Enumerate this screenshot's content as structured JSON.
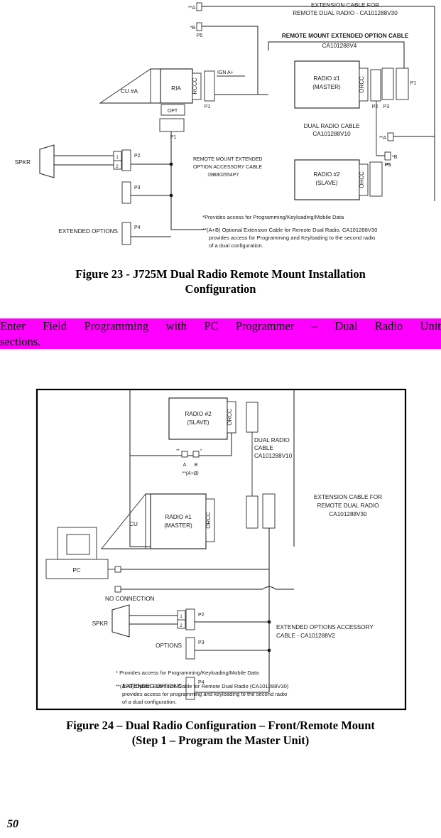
{
  "page": {
    "number": "50"
  },
  "figure23": {
    "caption_line1": "Figure 23 - J725M Dual Radio Remote Mount Installation",
    "caption_line2": "Configuration",
    "labels": {
      "ext_cable_for": "EXTENSION CABLE FOR",
      "remote_dual_radio": "REMOTE DUAL RADIO - CA101288V30",
      "conn_a_top": "**A",
      "conn_b": "*B",
      "p5_top": "P5",
      "remote_mount_ext_option_cable": "REMOTE MOUNT EXTENDED OPTION CABLE",
      "cable_pn_v4": "CA101288V4",
      "cu_a": "CU #A",
      "ria": "RIA",
      "rccc": "RCCC",
      "opt": "OPT",
      "p1_left": "P1",
      "p1_opt": "P1",
      "ign_a_plus": "IGN A+",
      "radio1_line1": "RADIO #1",
      "radio1_line2": "(MASTER)",
      "orcc1": "ORCC",
      "p2": "P2",
      "p3": "P3",
      "p1_right": "P1",
      "dual_radio_cable": "DUAL RADIO  CABLE",
      "dual_radio_cable_pn": "CA101288V10",
      "conn_a_bottom": "**A",
      "conn_b_bottom": "*B",
      "p5_bottom": "P5",
      "radio2_line1": "RADIO #2",
      "radio2_line2": "(SLAVE)",
      "orcc2": "ORCC",
      "spkr": "SPKR",
      "pin1": "1",
      "pin2": "2",
      "p2_spkr": "P2",
      "p3_mid": "P3",
      "p4": "P4",
      "extended_options": "EXTENDED OPTIONS",
      "accessory_cable_l1": "REMOTE MOUNT EXTENDED",
      "accessory_cable_l2": "OPTION ACCESSORY CABLE",
      "accessory_cable_l3": "19B802554P7",
      "note1": "*Provides access for Programming/Keyloading/Mobile Data",
      "note2_l1": "**(A+B) Optional Extension Cable for Remote Dual Radio, CA101288V30",
      "note2_l2": "provides access for Programming and Keyloading to the second radio",
      "note2_l3": "of a dual configuration."
    }
  },
  "highlight": {
    "color": "#ff00ff",
    "line1_words": [
      "Enter",
      "Field",
      "Programming",
      "with",
      "PC",
      "Programmer",
      "–",
      "Dual",
      "Radio",
      "Unit"
    ],
    "line2": "sections."
  },
  "figure24": {
    "caption_line1": "Figure 24 – Dual Radio Configuration – Front/Remote Mount",
    "caption_line2": "(Step 1 – Program the Master Unit)",
    "labels": {
      "radio2_line1": "RADIO #2",
      "radio2_line2": "(SLAVE)",
      "orcc2": "ORCC",
      "dual_radio_l1": "DUAL RADIO",
      "dual_radio_l2": "CABLE",
      "dual_radio_l3": "CA101288V10",
      "mark_a": "**",
      "mark_b": "*",
      "label_a": "A",
      "label_b": "B",
      "a_plus_b": "**(A+B)",
      "cu": "CU",
      "radio1_line1": "RADIO #1",
      "radio1_line2": "(MASTER)",
      "orcc1": "ORCC",
      "pc": "PC",
      "no_connection": "NO CONNECTION",
      "ext_cable_l1": "EXTENSION CABLE FOR",
      "ext_cable_l2": "REMOTE DUAL RADIO",
      "ext_cable_l3": "CA101288V30",
      "spkr": "SPKR",
      "pin1": "1",
      "pin2": "2",
      "p2": "P2",
      "options": "OPTIONS",
      "p3": "P3",
      "extended_options": "EXTENDED OPTIONS",
      "p4": "P4",
      "ext_opt_acc_l1": "EXTENDED OPTIONS ACCESSORY",
      "ext_opt_acc_l2": "CABLE - CA101288V2",
      "note1": "* Provides access for Programming/Keyloading/Mobile Data",
      "note2_l1": "**(A+B) Option Extension Cable for Remote Dual Radio (CA101288V30)",
      "note2_l2": "provides access for programming and keyloading to the second radio",
      "note2_l3": "of a dual configuration."
    }
  }
}
